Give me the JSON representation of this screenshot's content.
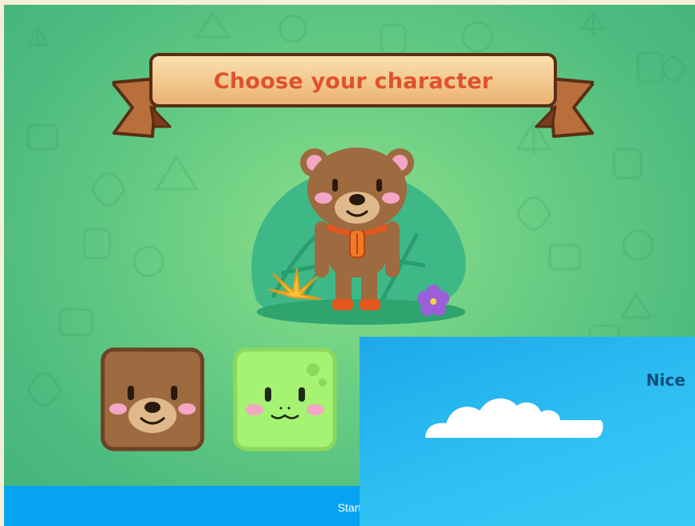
{
  "banner": {
    "title": "Choose your character"
  },
  "characters": [
    {
      "name": "bear",
      "color": "#9e6a3f"
    },
    {
      "name": "dino",
      "color": "#a6f272"
    }
  ],
  "start_bar": {
    "label": "Start"
  },
  "overlay": {
    "title": "Nice"
  },
  "colors": {
    "background_green": "#5cc781",
    "banner_text": "#e0512b",
    "start_bar": "#06a3f2",
    "overlay_sky": "#2fc1f3"
  }
}
